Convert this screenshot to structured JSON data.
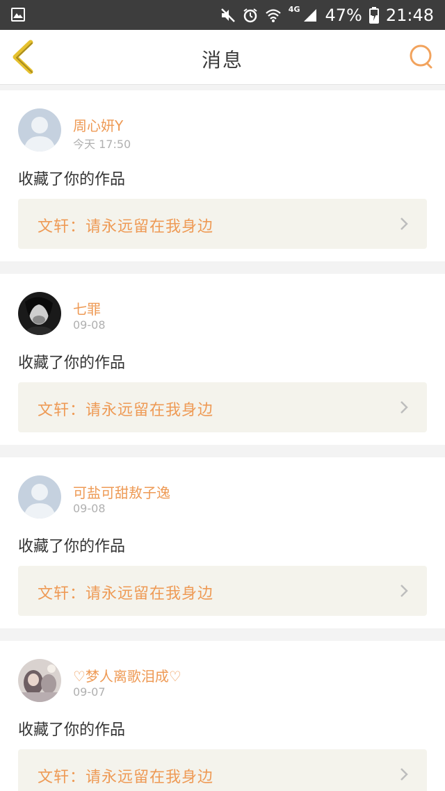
{
  "status_bar": {
    "battery": "47%",
    "time": "21:48",
    "network": "4G",
    "icons": [
      "gallery-icon",
      "mute-icon",
      "alarm-icon",
      "wifi-icon",
      "signal-icon",
      "battery-charging-icon"
    ]
  },
  "header": {
    "title": "消息",
    "back_icon": "chevron-left-icon",
    "search_icon": "search-icon"
  },
  "colors": {
    "accent": "#ee9a55",
    "back_icon": "#e6c12e",
    "work_box_bg": "#f4f3ec"
  },
  "messages": [
    {
      "user": "周心妍Y",
      "time": "今天 17:50",
      "action": "收藏了你的作品",
      "work": "文轩：请永远留在我身边",
      "avatar": "default-avatar"
    },
    {
      "user": "七罪",
      "time": "09-08",
      "action": "收藏了你的作品",
      "work": "文轩：请永远留在我身边",
      "avatar": "photo-avatar-dark"
    },
    {
      "user": "可盐可甜敖子逸",
      "time": "09-08",
      "action": "收藏了你的作品",
      "work": "文轩：请永远留在我身边",
      "avatar": "default-avatar"
    },
    {
      "user": "♡梦人离歌泪成♡",
      "time": "09-07",
      "action": "收藏了你的作品",
      "work": "文轩：请永远留在我身边",
      "avatar": "photo-avatar-light"
    }
  ]
}
